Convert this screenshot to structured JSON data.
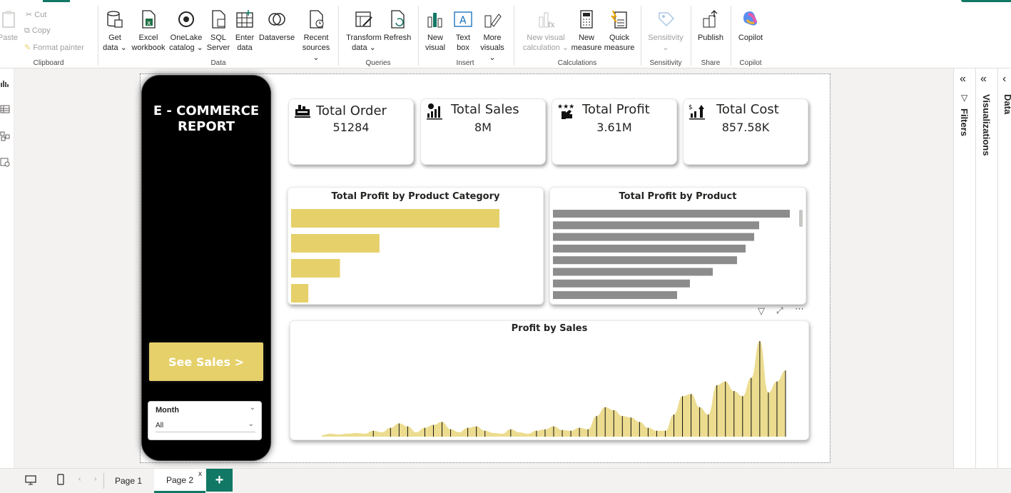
{
  "ribbon": {
    "clipboard": {
      "paste": "Paste",
      "cut": "Cut",
      "copy": "Copy",
      "format_painter": "Format painter",
      "label": "Clipboard"
    },
    "data": {
      "get_data": [
        "Get",
        "data ⌄"
      ],
      "excel": [
        "Excel",
        "workbook"
      ],
      "onelake": [
        "OneLake",
        "catalog ⌄"
      ],
      "sql": [
        "SQL",
        "Server"
      ],
      "enter": [
        "Enter",
        "data"
      ],
      "dataverse": [
        "Dataverse",
        ""
      ],
      "recent": [
        "Recent",
        "sources ⌄"
      ],
      "label": "Data"
    },
    "queries": {
      "transform": [
        "Transform",
        "data ⌄"
      ],
      "refresh": [
        "Refresh",
        ""
      ],
      "label": "Queries"
    },
    "insert": {
      "new_visual": [
        "New",
        "visual"
      ],
      "text_box": [
        "Text",
        "box"
      ],
      "more_visuals": [
        "More",
        "visuals ⌄"
      ],
      "label": "Insert"
    },
    "calculations": {
      "new_visual_calc": [
        "New visual",
        "calculation ⌄"
      ],
      "new_measure": [
        "New",
        "measure"
      ],
      "quick_measure": [
        "Quick",
        "measure"
      ],
      "label": "Calculations"
    },
    "sensitivity": {
      "button": [
        "Sensitivity",
        "⌄"
      ],
      "label": "Sensitivity"
    },
    "share": {
      "publish": "Publish",
      "label": "Share"
    },
    "copilot": {
      "button": "Copilot",
      "label": "Copilot"
    }
  },
  "report": {
    "title": "E - COMMERCE REPORT",
    "see_sales": "See Sales >",
    "slicer": {
      "title": "Month",
      "value": "All"
    },
    "kpis": [
      {
        "label": "Total Order",
        "value": "51284",
        "icon": "orders-icon"
      },
      {
        "label": "Total Sales",
        "value": "8M",
        "icon": "sales-icon"
      },
      {
        "label": "Total Profit",
        "value": "3.61M",
        "icon": "profit-icon"
      },
      {
        "label": "Total Cost",
        "value": "857.58K",
        "icon": "cost-icon"
      }
    ]
  },
  "chart_data": [
    {
      "type": "bar",
      "title": "Total Profit by Product Category",
      "orientation": "horizontal",
      "values": [
        290,
        123,
        68,
        24
      ],
      "color": "#e6d06a"
    },
    {
      "type": "bar",
      "title": "Total Profit by Product",
      "orientation": "horizontal",
      "values": [
        332,
        289,
        282,
        270,
        258,
        224,
        192,
        174
      ],
      "color": "#8c8c8c"
    },
    {
      "type": "area",
      "title": "Profit by Sales",
      "color": "#e6d06a",
      "values": [
        2,
        4,
        3,
        4,
        5,
        4,
        8,
        6,
        12,
        18,
        14,
        6,
        12,
        16,
        20,
        10,
        6,
        12,
        14,
        8,
        5,
        4,
        10,
        6,
        4,
        8,
        10,
        14,
        9,
        8,
        12,
        10,
        28,
        40,
        36,
        28,
        26,
        20,
        12,
        8,
        8,
        30,
        55,
        58,
        40,
        30,
        70,
        75,
        62,
        55,
        80,
        130,
        60,
        75,
        90
      ]
    }
  ],
  "panels": {
    "filters": "Filters",
    "visualizations": "Visualizations",
    "data": "Data"
  },
  "pages": {
    "page1": "Page 1",
    "page2": "Page 2",
    "add": "+",
    "close": "x"
  }
}
